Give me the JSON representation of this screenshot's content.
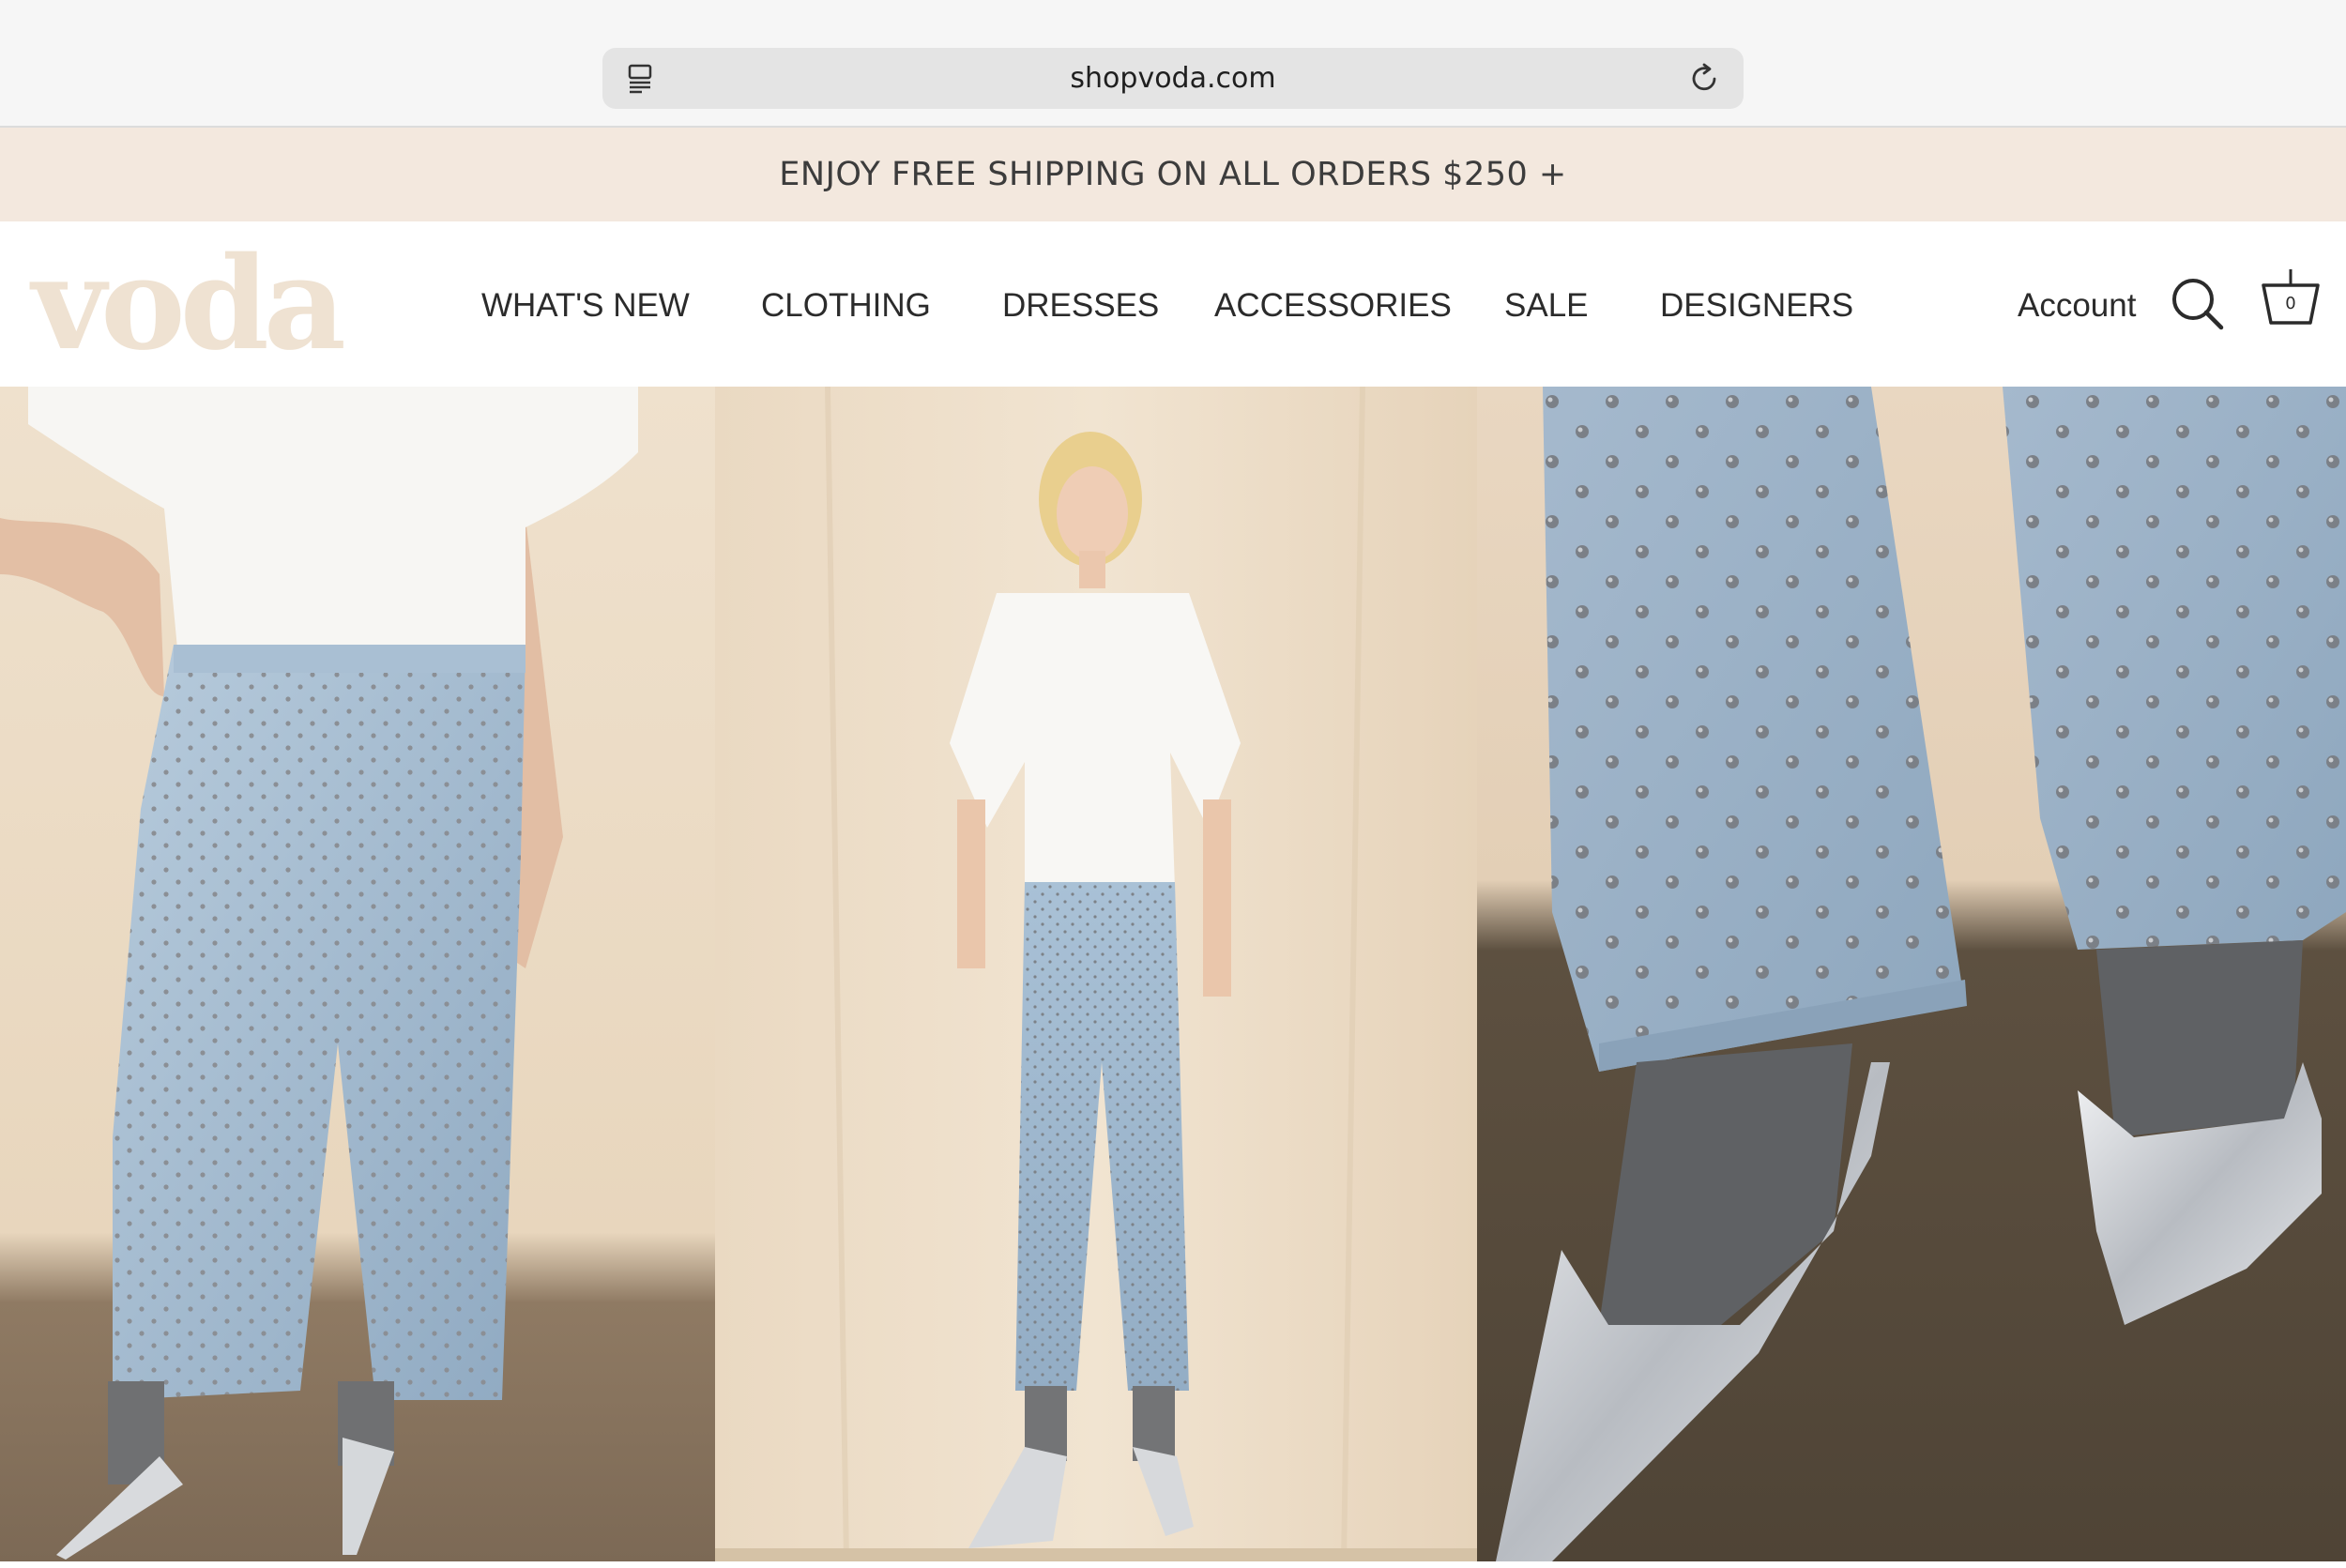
{
  "browser": {
    "url": "shopvoda.com",
    "reader_icon": "reader-view-icon",
    "reload_icon": "reload-icon"
  },
  "announcement": {
    "text": "ENJOY FREE SHIPPING ON ALL ORDERS $250 +"
  },
  "header": {
    "logo_text": "voda",
    "nav": [
      {
        "label": "WHAT'S NEW"
      },
      {
        "label": "CLOTHING"
      },
      {
        "label": "DRESSES"
      },
      {
        "label": "ACCESSORIES"
      },
      {
        "label": "SALE"
      },
      {
        "label": "DESIGNERS"
      }
    ],
    "account_label": "Account",
    "search_icon": "search-icon",
    "cart_icon": "basket-icon",
    "cart_count": "0"
  },
  "colors": {
    "announcement_bg": "#f3e8de",
    "logo": "#efe2d2",
    "text": "#2b2b2b"
  },
  "hero": {
    "images": [
      {
        "name": "hero-image-studded-jeans-torso"
      },
      {
        "name": "hero-image-model-full-length"
      },
      {
        "name": "hero-image-jeans-hem-silver-heels"
      }
    ]
  }
}
